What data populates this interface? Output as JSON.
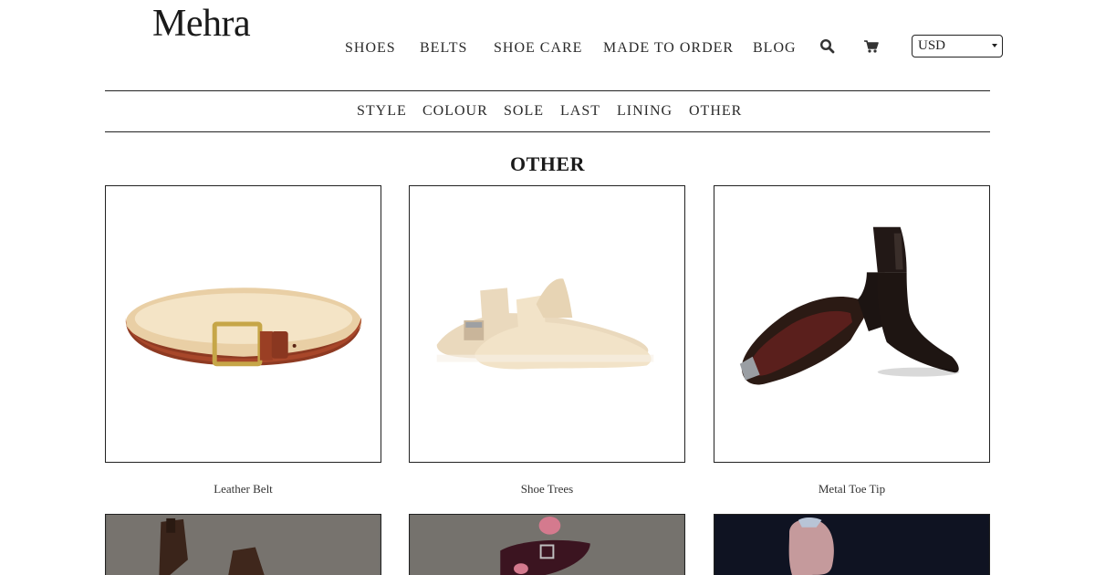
{
  "brand": {
    "logo": "Mehra"
  },
  "main_nav": [
    {
      "label": "SHOES"
    },
    {
      "label": "BELTS"
    },
    {
      "label": "SHOE CARE"
    },
    {
      "label": "MADE TO ORDER"
    },
    {
      "label": "BLOG"
    }
  ],
  "icons": {
    "search": "search-icon",
    "cart": "cart-icon"
  },
  "currency": {
    "selected": "USD"
  },
  "sub_nav": [
    {
      "label": "STYLE"
    },
    {
      "label": "COLOUR"
    },
    {
      "label": "SOLE"
    },
    {
      "label": "LAST"
    },
    {
      "label": "LINING"
    },
    {
      "label": "OTHER"
    }
  ],
  "section": {
    "title": "OTHER"
  },
  "products": [
    {
      "name": "Leather Belt"
    },
    {
      "name": "Shoe Trees"
    },
    {
      "name": "Metal Toe Tip"
    }
  ]
}
